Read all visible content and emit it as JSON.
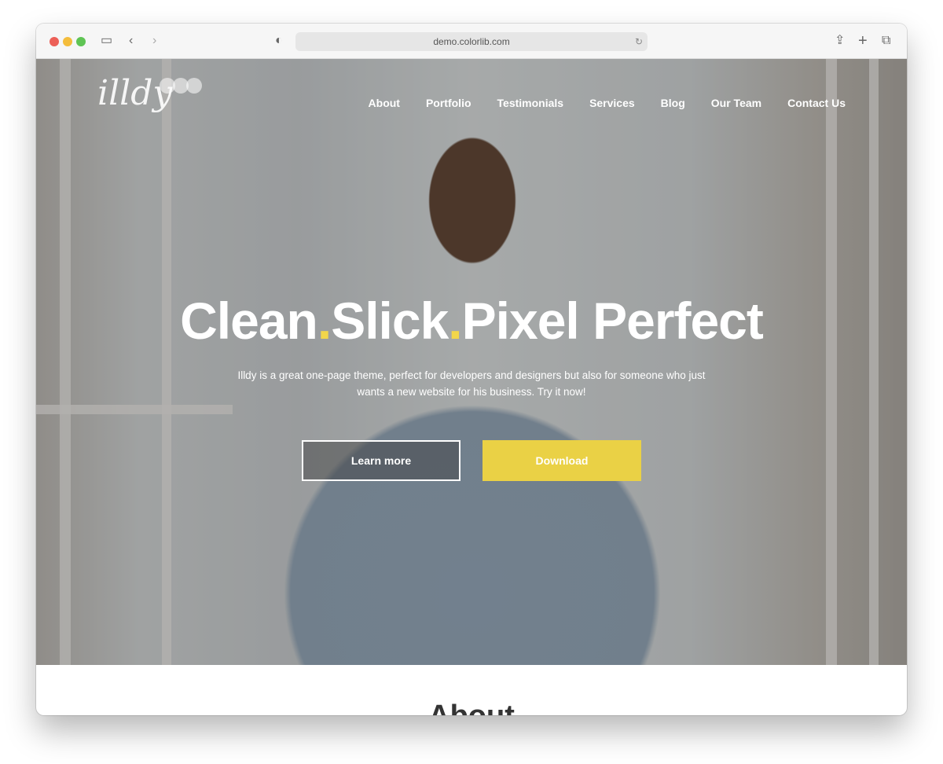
{
  "browser": {
    "url": "demo.colorlib.com"
  },
  "site": {
    "logo": "illdy",
    "nav": [
      "About",
      "Portfolio",
      "Testimonials",
      "Services",
      "Blog",
      "Our Team",
      "Contact Us"
    ],
    "headline": {
      "part1": "Clean",
      "part2": "Slick",
      "part3": "Pixel Perfect",
      "dot": "."
    },
    "subtitle": "Illdy is a great one-page theme, perfect for developers and designers but also for someone who just wants a new website for his business. Try it now!",
    "buttons": {
      "learn_more": "Learn more",
      "download": "Download"
    },
    "section_title": "About"
  },
  "colors": {
    "accent": "#ead145"
  }
}
